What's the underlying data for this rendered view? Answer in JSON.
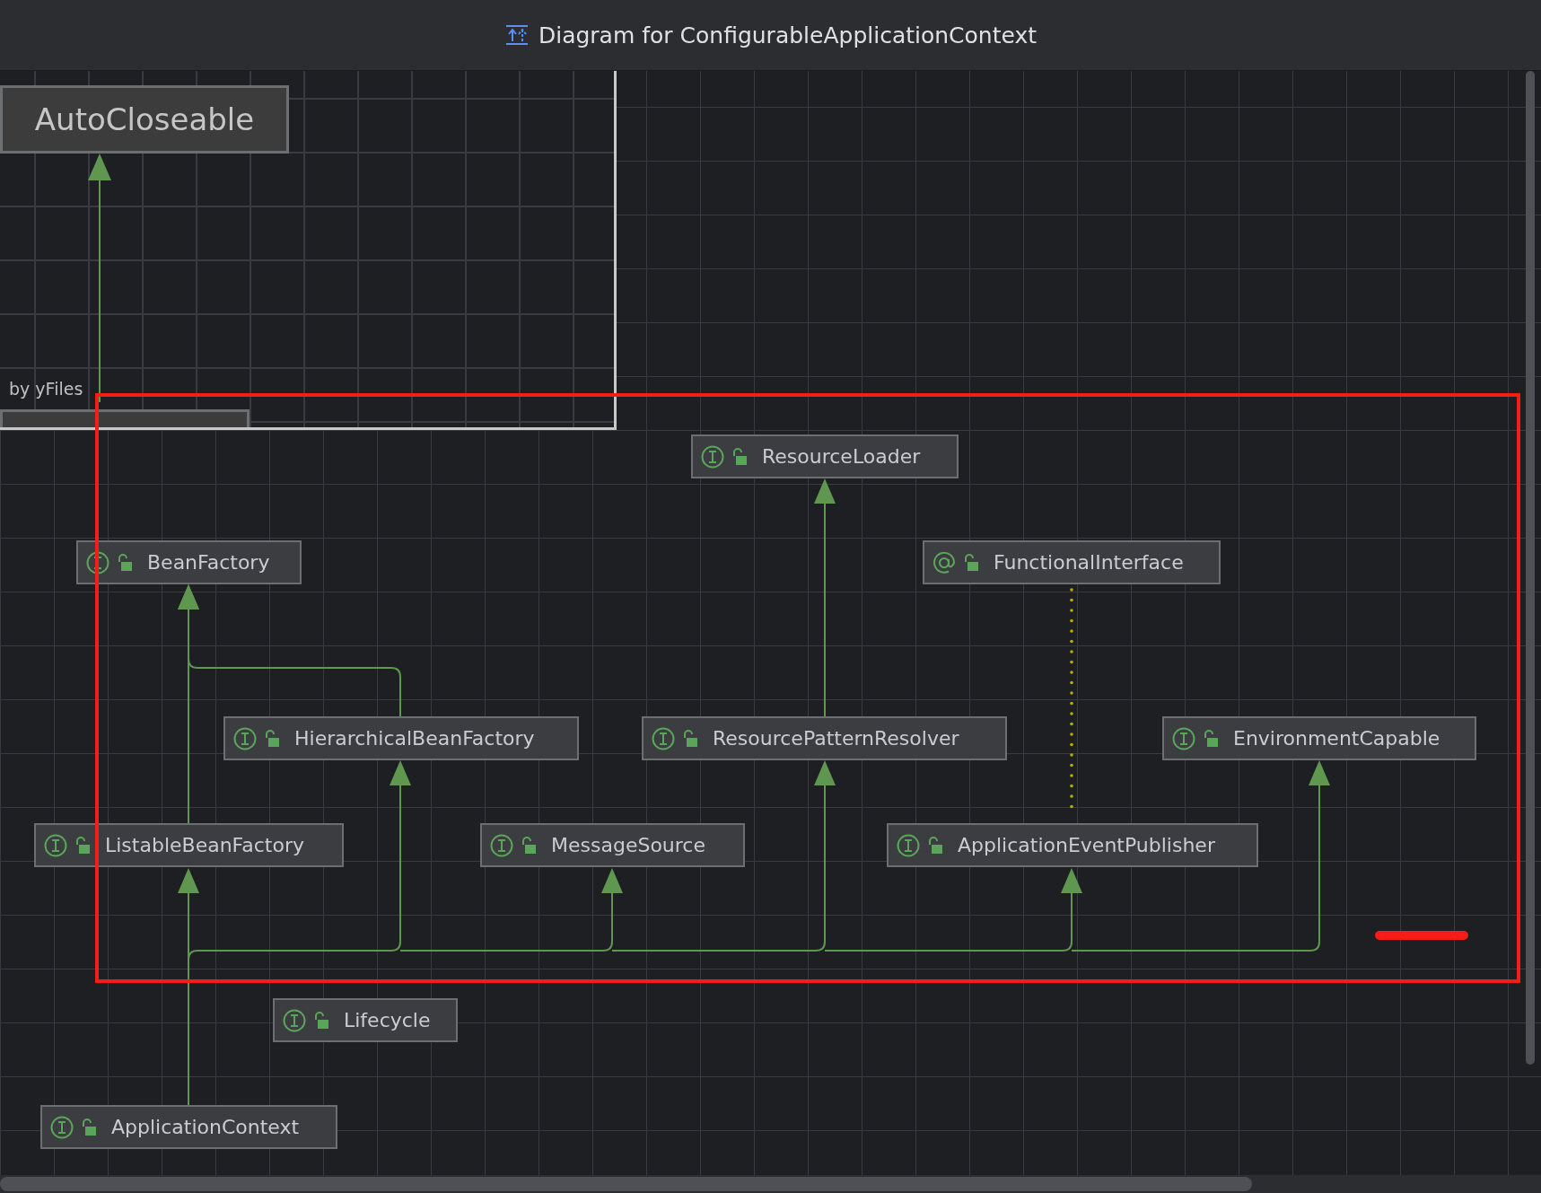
{
  "window": {
    "title": "Diagram for ConfigurableApplicationContext"
  },
  "overview": {
    "nodes": [
      {
        "label": "AutoCloseable"
      }
    ],
    "credit": "by yFiles"
  },
  "diagram": {
    "nodes": [
      {
        "label": "ResourceLoader",
        "kind": "interface"
      },
      {
        "label": "BeanFactory",
        "kind": "interface"
      },
      {
        "label": "FunctionalInterface",
        "kind": "annotation"
      },
      {
        "label": "HierarchicalBeanFactory",
        "kind": "interface"
      },
      {
        "label": "ResourcePatternResolver",
        "kind": "interface"
      },
      {
        "label": "EnvironmentCapable",
        "kind": "interface"
      },
      {
        "label": "ListableBeanFactory",
        "kind": "interface"
      },
      {
        "label": "MessageSource",
        "kind": "interface"
      },
      {
        "label": "ApplicationEventPublisher",
        "kind": "interface"
      },
      {
        "label": "Lifecycle",
        "kind": "interface"
      },
      {
        "label": "ApplicationContext",
        "kind": "interface"
      }
    ]
  }
}
